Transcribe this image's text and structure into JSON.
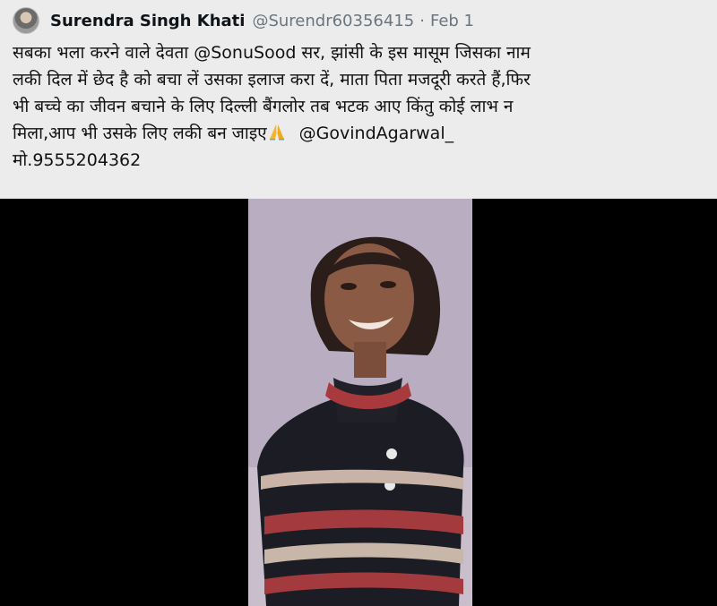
{
  "tweet": {
    "author_name": "Surendra Singh Khati",
    "author_handle": "@Surendr60356415",
    "separator": "·",
    "date": "Feb 1",
    "avatar_icon": "user-avatar",
    "lines": [
      "सबका भला करने वाले देवता @SonuSood सर, झांसी के इस मासूम जिसका नाम",
      "लकी दिल में छेद है को बचा लें उसका इलाज करा दें, माता पिता मजदूरी करते हैं,फिर",
      "भी बच्चे का जीवन बचाने के लिए दिल्ली बैंगलोर तब भटक आए किंतु कोई लाभ न",
      "मिला,आप भी उसके लिए लकी बन जाइए",
      "@GovindAgarwal_",
      "मो.9555204362"
    ],
    "emoji_icon": "folded-hands-icon",
    "media": {
      "type": "video",
      "background_color": "#000000"
    }
  }
}
